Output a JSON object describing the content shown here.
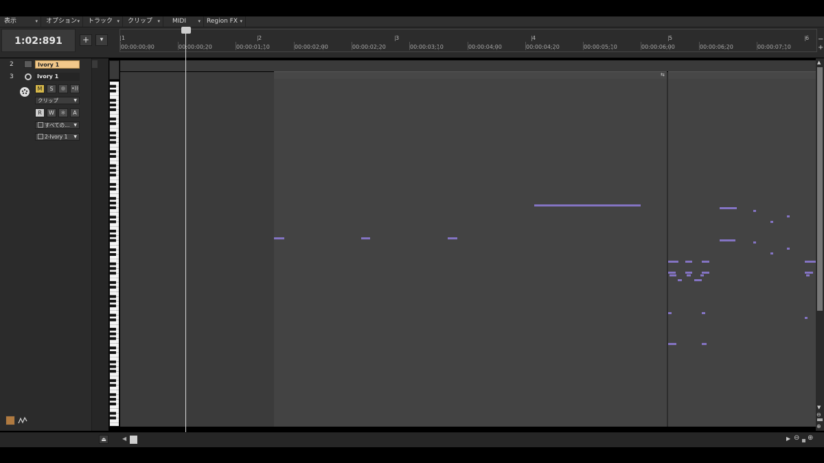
{
  "menubar": {
    "items": [
      "表示",
      "オプション",
      "トラック",
      "クリップ",
      "MIDI",
      "Region FX"
    ]
  },
  "transport": {
    "time": "1:02:891",
    "add_label": "+",
    "dropdown_label": "▾"
  },
  "ruler": {
    "bars": [
      "1",
      "2",
      "3",
      "4",
      "5",
      "6"
    ],
    "timecodes": [
      "00:00:00;00",
      "00:00:00;20",
      "00:00:01;10",
      "00:00:02;00",
      "00:00:02;20",
      "00:00:03;10",
      "00:00:04;00",
      "00:00:04;20",
      "00:00:05;10",
      "00:00:06;00",
      "00:00:06;20",
      "00:00:07;10"
    ]
  },
  "tracks": [
    {
      "number": "2",
      "name": "Ivory 1",
      "selected": true
    },
    {
      "number": "3",
      "name": "Ivory 1",
      "selected": false
    }
  ],
  "track3": {
    "mute": "M",
    "solo": "S",
    "read": "R",
    "write": "W",
    "automation": "A",
    "mode": "クリップ",
    "input": "すべての...",
    "output": "2-Ivory 1"
  },
  "colors": {
    "note": "#8474c4",
    "selected_track": "#f2c88a",
    "mute_active": "#d6b84a"
  }
}
